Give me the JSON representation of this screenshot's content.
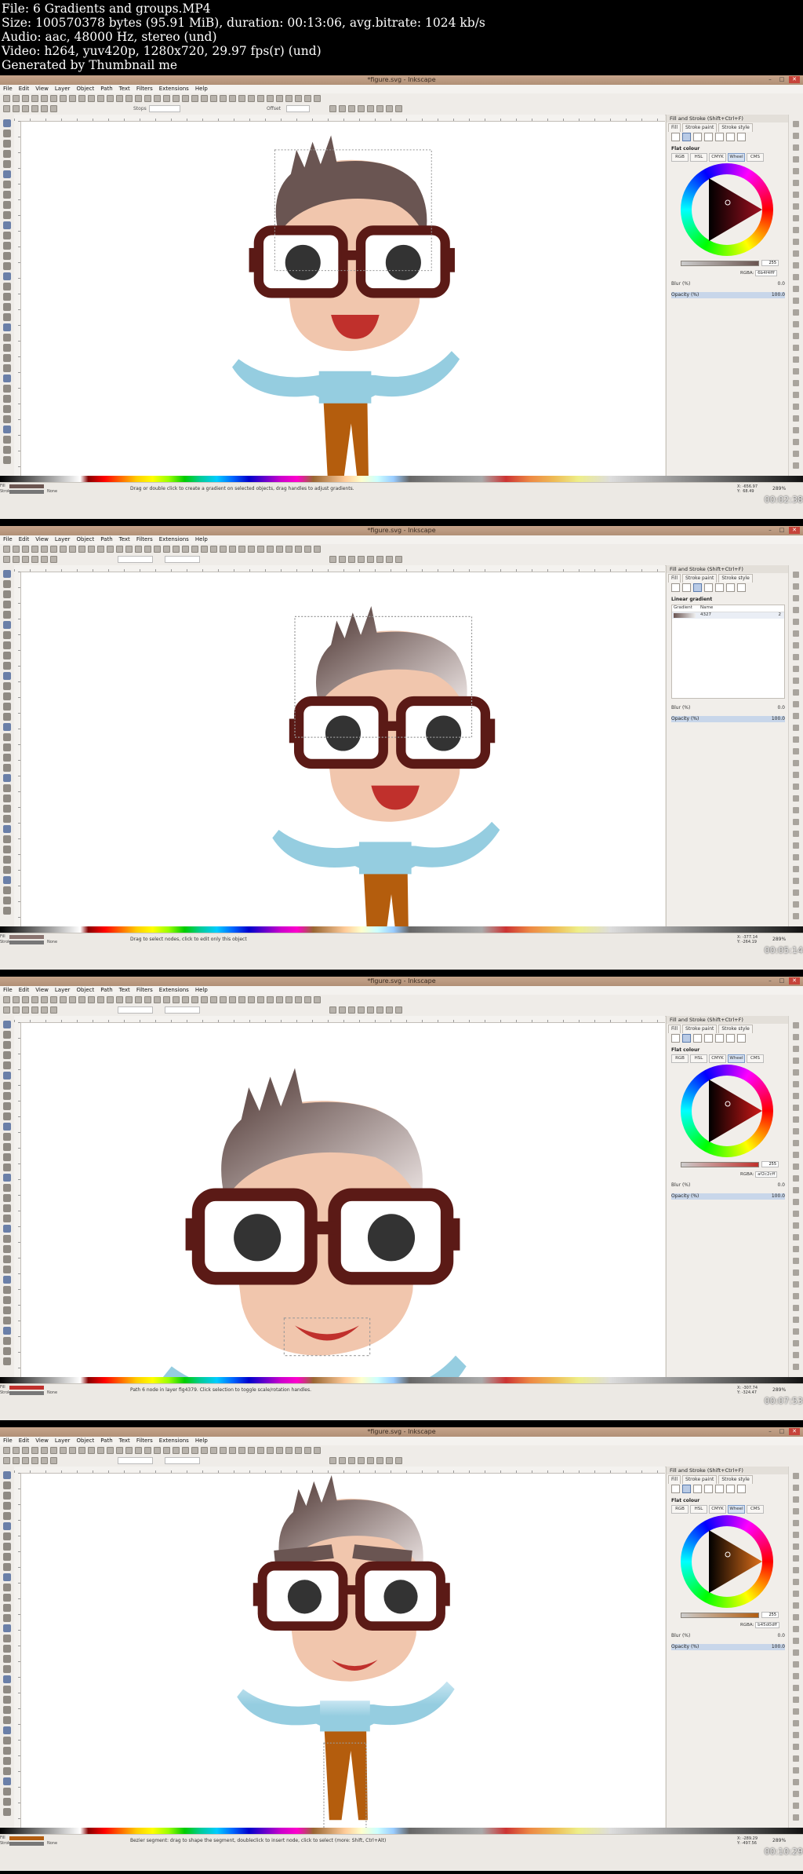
{
  "header": {
    "lines": [
      "File: 6 Gradients and groups.MP4",
      "Size: 100570378 bytes (95.91 MiB), duration: 00:13:06, avg.bitrate: 1024 kb/s",
      "Audio: aac, 48000 Hz, stereo (und)",
      "Video: h264, yuv420p, 1280x720, 29.97 fps(r) (und)",
      "Generated by Thumbnail me"
    ]
  },
  "app": {
    "window_title": "*figure.svg - Inkscape",
    "menus": [
      "File",
      "Edit",
      "View",
      "Layer",
      "Object",
      "Path",
      "Text",
      "Filters",
      "Extensions",
      "Help"
    ]
  },
  "frames": [
    {
      "timestamp": "00:02:38",
      "status_message": "Drag or double click to create a gradient on selected objects, drag handles to adjust gradients.",
      "status_fill_label": "Fill",
      "status_stroke_label": "Stroke",
      "status_stroke_value": "None",
      "fill_swatch_color": "#6b5550",
      "coords": "X: -656.97\nY:  68.49",
      "zoom": "289%",
      "panel_mode": "flat",
      "panel_title": "Fill and Stroke (Shift+Ctrl+F)",
      "panel_tabs": [
        "Fill",
        "Stroke paint",
        "Stroke style"
      ],
      "flat_colour_label": "Flat colour",
      "colour_modes": [
        "RGB",
        "HSL",
        "CMYK",
        "Wheel",
        "CMS"
      ],
      "alpha_value": "255",
      "rgba_label": "RGBA:",
      "rgba_value": "6b4f4fff",
      "blur_label": "Blur (%)",
      "blur_value": "0.0",
      "opacity_label": "Opacity (%)",
      "opacity_value": "100.0",
      "wheel_hue": "#a01020",
      "tool_label_mid": "Stops",
      "tool_label_right": "Offset"
    },
    {
      "timestamp": "00:05:14",
      "status_message": "Drag to select nodes, click to edit only this object",
      "status_fill_label": "Fill",
      "status_stroke_label": "Stroke",
      "status_stroke_value": "None",
      "fill_swatch_color": "#8a7470",
      "coords": "X: -377.14\nY: -264.19",
      "zoom": "289%",
      "panel_mode": "gradient",
      "panel_title": "Fill and Stroke (Shift+Ctrl+F)",
      "panel_tabs": [
        "Fill",
        "Stroke paint",
        "Stroke style"
      ],
      "gradient_label": "Linear gradient",
      "gradient_header_a": "Gradient",
      "gradient_header_b": "Name",
      "gradient_row_name": "4327",
      "gradient_row_count": "2",
      "blur_label": "Blur (%)",
      "blur_value": "0.0",
      "opacity_label": "Opacity (%)",
      "opacity_value": "100.0"
    },
    {
      "timestamp": "00:07:53",
      "status_message": "Path 6 node in layer fig4379. Click selection to toggle scale/rotation handles.",
      "status_fill_label": "Fill",
      "status_stroke_label": "Stroke",
      "status_stroke_value": "None",
      "fill_swatch_color": "#c0302c",
      "coords": "X: -307.74\nY: -324.47",
      "zoom": "289%",
      "panel_mode": "flat",
      "panel_title": "Fill and Stroke (Shift+Ctrl+F)",
      "panel_tabs": [
        "Fill",
        "Stroke paint",
        "Stroke style"
      ],
      "flat_colour_label": "Flat colour",
      "colour_modes": [
        "RGB",
        "HSL",
        "CMYK",
        "Wheel",
        "CMS"
      ],
      "alpha_value": "255",
      "rgba_label": "RGBA:",
      "rgba_value": "af2c2cff",
      "blur_label": "Blur (%)",
      "blur_value": "0.0",
      "opacity_label": "Opacity (%)",
      "opacity_value": "100.0",
      "wheel_hue": "#d01818"
    },
    {
      "timestamp": "00:10:29",
      "status_message": "Bezier segment: drag to shape the segment, doubleclick to insert node, click to select (more: Shift, Ctrl+Alt)",
      "status_fill_label": "Fill",
      "status_stroke_label": "Stroke",
      "status_stroke_value": "None",
      "fill_swatch_color": "#b25d10",
      "coords": "X: -289.29\nY: -497.56",
      "zoom": "289%",
      "panel_mode": "flat",
      "panel_title": "Fill and Stroke (Shift+Ctrl+F)",
      "panel_tabs": [
        "Fill",
        "Stroke paint",
        "Stroke style"
      ],
      "flat_colour_label": "Flat colour",
      "colour_modes": [
        "RGB",
        "HSL",
        "CMYK",
        "Wheel",
        "CMS"
      ],
      "alpha_value": "255",
      "rgba_label": "RGBA:",
      "rgba_value": "b45d0dff",
      "blur_label": "Blur (%)",
      "blur_value": "0.0",
      "opacity_label": "Opacity (%)",
      "opacity_value": "100.0",
      "wheel_hue": "#e0701a"
    }
  ],
  "colors": {
    "skin": "#f1c6ad",
    "hair": "#6a5552",
    "glasses": "#5b1a16",
    "mouth": "#c0302c",
    "shirt": "#95cde0",
    "pants": "#b45d0d"
  }
}
